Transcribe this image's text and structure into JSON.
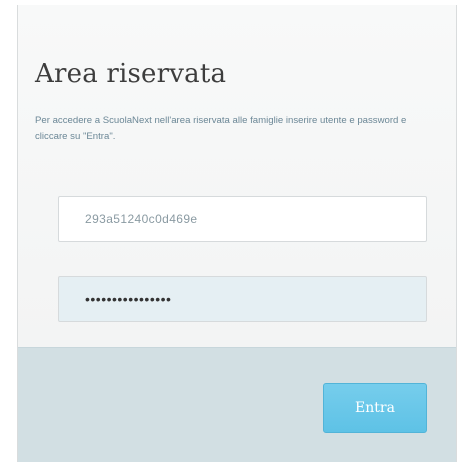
{
  "login": {
    "title": "Area riservata",
    "description": "Per accedere a ScuolaNext nell'area riservata alle famiglie inserire utente e password e cliccare su \"Entra\".",
    "username_value": "293a51240c0d469e",
    "password_value": "••••••••••••••••",
    "submit_label": "Entra"
  },
  "colors": {
    "accent": "#62c3e7",
    "footer": "#d2dfe3",
    "description_text": "#6b8796"
  }
}
